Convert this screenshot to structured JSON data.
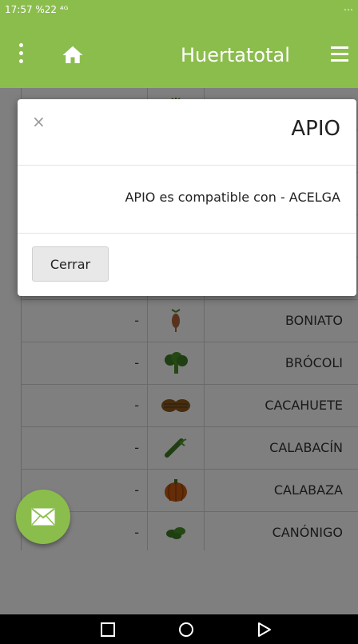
{
  "status_bar": {
    "time": "17:57",
    "battery_percent": "%22",
    "left_text": "17:57 %22 ⁴ᴳ",
    "right_text": "⋯"
  },
  "app_bar": {
    "title": "Huertatotal"
  },
  "table": {
    "rows": [
      {
        "name": "",
        "value": "",
        "icon": "radish-icon"
      },
      {
        "name": "",
        "value": "",
        "icon": "vegetable-icon"
      },
      {
        "name": "",
        "value": "",
        "icon": "vegetable-icon"
      },
      {
        "name": "",
        "value": "",
        "icon": "vegetable-icon"
      },
      {
        "name": "",
        "value": "",
        "icon": "vegetable-icon"
      },
      {
        "name": "BONIATO",
        "value": "-",
        "icon": "sweet-potato-icon"
      },
      {
        "name": "BRÓCOLI",
        "value": "-",
        "icon": "broccoli-icon"
      },
      {
        "name": "CACAHUETE",
        "value": "-",
        "icon": "peanut-icon"
      },
      {
        "name": "CALABACÍN",
        "value": "-",
        "icon": "zucchini-icon"
      },
      {
        "name": "CALABAZA",
        "value": "-",
        "icon": "pumpkin-icon"
      },
      {
        "name": "CANÓNIGO",
        "value": "-",
        "icon": "lambs-lettuce-icon"
      }
    ]
  },
  "modal": {
    "title": "APIO",
    "message": "APIO es compatible con - ACELGA",
    "close_glyph": "×",
    "button_label": "Cerrar"
  },
  "colors": {
    "primary": "#8bbd4c",
    "overlay": "rgba(0,0,0,0.5)"
  }
}
